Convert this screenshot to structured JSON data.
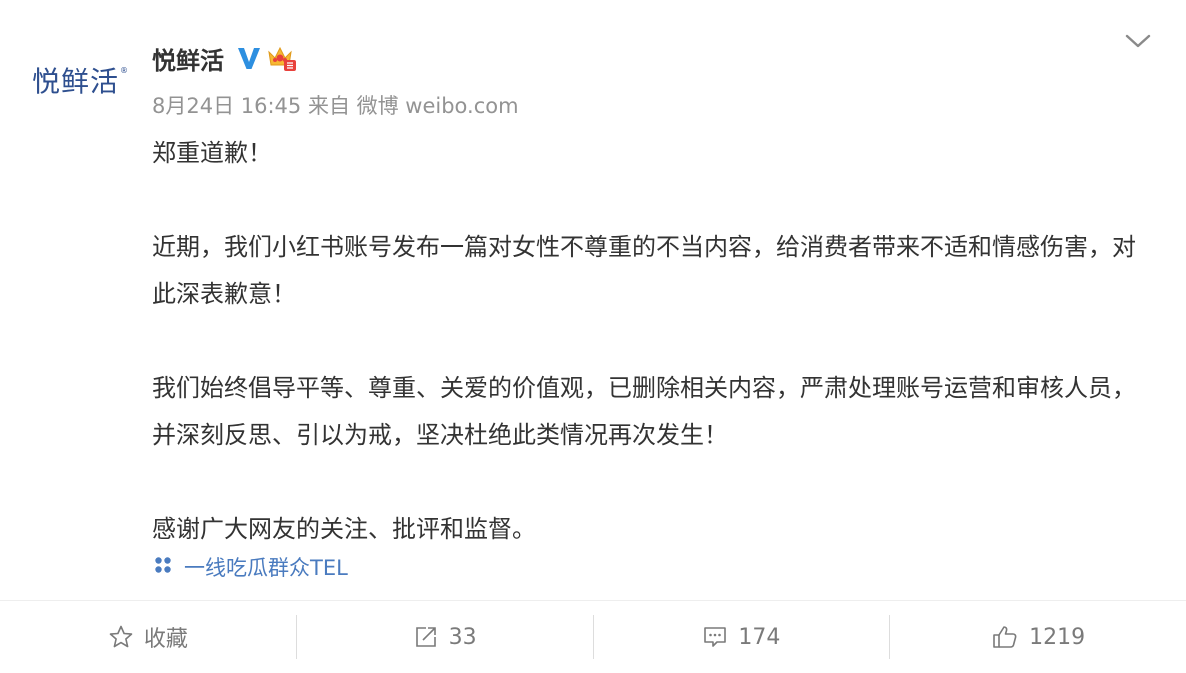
{
  "account": {
    "avatar_logo_text": "悦鲜活",
    "avatar_tm": "®",
    "name": "悦鲜活",
    "meta": "8月24日 16:45 来自 微博 weibo.com"
  },
  "post": {
    "paragraphs": [
      "郑重道歉！",
      "",
      "近期，我们小红书账号发布一篇对女性不尊重的不当内容，给消费者带来不适和情感伤害，对此深表歉意！",
      "",
      "我们始终倡导平等、尊重、关爱的价值观，已删除相关内容，严肃处理账号运营和审核人员，并深刻反思、引以为戒，坚决杜绝此类情况再次发生！",
      "",
      "感谢广大网友的关注、批评和监督。"
    ],
    "source_link": "一线吃瓜群众TEL"
  },
  "toolbar": {
    "favorite_label": "收藏",
    "repost_count": "33",
    "comment_count": "174",
    "like_count": "1219"
  },
  "colors": {
    "link": "#4a7bbf",
    "verified_badge": "#2d8fe0",
    "muted_text": "#939393"
  }
}
